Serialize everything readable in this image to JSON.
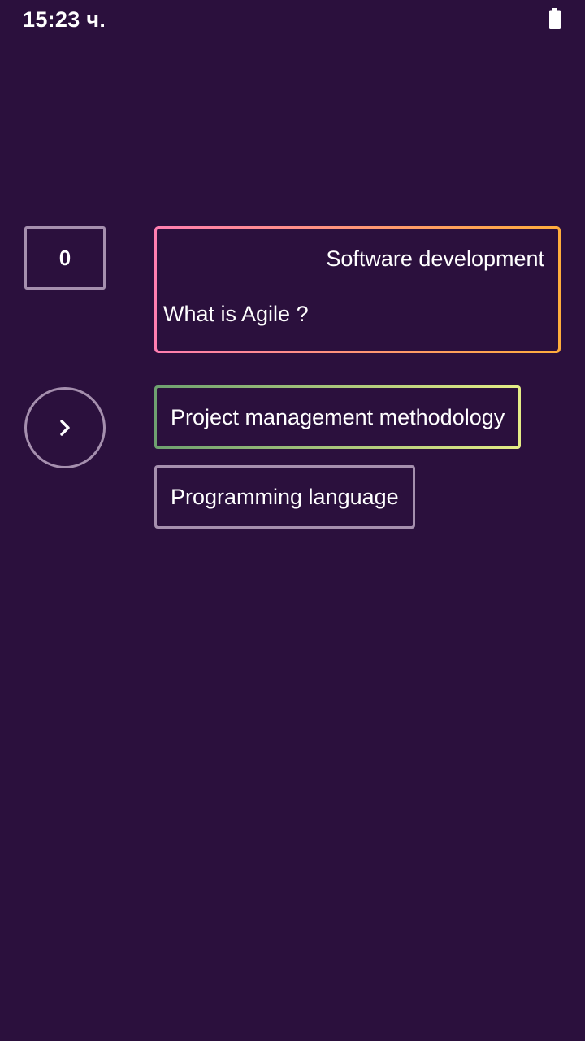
{
  "status_bar": {
    "time": "15:23 ч.",
    "battery_icon": "battery-full-icon"
  },
  "score": {
    "value": "0"
  },
  "question": {
    "category": "Software development",
    "text": "What is Agile ?"
  },
  "next_button": {
    "icon": "chevron-right-icon"
  },
  "answers": [
    {
      "label": "Project management methodology"
    },
    {
      "label": "Programming language"
    }
  ],
  "colors": {
    "background": "#2b103d",
    "question_border_start": "#ff7eb1",
    "question_border_end": "#ffad3c",
    "answer1_border_start": "#6ea070",
    "answer1_border_end": "#e5ec86",
    "neutral_border": "#a58fae"
  }
}
